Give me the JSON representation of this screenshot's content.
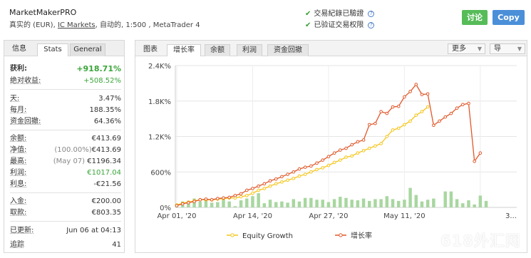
{
  "header": {
    "system_name": "MarketMakerPRO",
    "meta_prefix": "真实的 (EUR),",
    "broker_link": "IC Markets",
    "meta_suffix": ", 自动的, 1:500 , MetaTrader 4",
    "verify_1": "交易紀錄已驗證",
    "verify_2": "已验证交易权限",
    "discuss_label": "讨论",
    "copy_label": "Copy"
  },
  "left_panel": {
    "tabs": [
      "信息",
      "Stats",
      "General"
    ],
    "stats": {
      "gain_label": "获利:",
      "gain_value": "+918.71%",
      "absgain_label": "绝对收益:",
      "absgain_value": "+508.52%",
      "daily_label": "天:",
      "daily_value": "3.47%",
      "monthly_label": "每月:",
      "monthly_value": "188.35%",
      "drawdown_label": "资金回撤:",
      "drawdown_value": "64.36%",
      "balance_label": "余额:",
      "balance_value": "€413.69",
      "equity_label": "净值:",
      "equity_pct": "(100.00%)",
      "equity_value": "€413.69",
      "highest_label": "最高:",
      "highest_date": "(May 07)",
      "highest_value": "€1196.34",
      "profit_label": "利润:",
      "profit_value": "€1017.04",
      "interest_label": "利息:",
      "interest_value": "-€21.56",
      "deposits_label": "入金:",
      "deposits_value": "€200.00",
      "withdrawals_label": "取款:",
      "withdrawals_value": "€803.35",
      "updated_label": "已更新:",
      "updated_value": "Jun 06 at 04:13",
      "tracking_label": "追踪",
      "tracking_value": "41"
    }
  },
  "right_panel": {
    "tab_label": "图表",
    "tabs": [
      "增长率",
      "余额",
      "利润",
      "资金回撤"
    ],
    "more_label": "更多",
    "export_label": "导"
  },
  "chart_data": {
    "type": "line",
    "y_tick_labels": [
      "0%",
      "600%",
      "1.2K%",
      "1.8K%",
      "2.4K%"
    ],
    "ylim": [
      0,
      2400
    ],
    "x_tick_labels": [
      "Apr 01, '20",
      "Apr 14, '20",
      "Apr 27, '20",
      "May 11, '20",
      "3..."
    ],
    "grid": true,
    "legend_position": "bottom",
    "series": [
      {
        "name": "Equity Growth",
        "color": "#f5c518",
        "values": [
          40,
          70,
          90,
          110,
          130,
          130,
          125,
          140,
          150,
          160,
          160,
          180,
          200,
          240,
          290,
          320,
          360,
          400,
          430,
          460,
          490,
          530,
          560,
          600,
          640,
          670,
          710,
          760,
          800,
          850,
          870,
          920,
          960,
          1000,
          1040,
          1080,
          1200,
          1310,
          1340,
          1400,
          1460,
          1560,
          1620,
          1700,
          null,
          null,
          null,
          null,
          null,
          null,
          null,
          null,
          null,
          null,
          null,
          null,
          null,
          null,
          null
        ]
      },
      {
        "name": "增长率",
        "color": "#e0582a",
        "values": [
          30,
          60,
          80,
          100,
          130,
          140,
          130,
          150,
          160,
          170,
          200,
          230,
          290,
          320,
          360,
          400,
          450,
          480,
          520,
          560,
          600,
          650,
          680,
          700,
          750,
          800,
          860,
          920,
          970,
          1000,
          1060,
          1110,
          1140,
          1400,
          1420,
          1620,
          1590,
          1700,
          1710,
          1870,
          1960,
          2080,
          1910,
          1920,
          1390,
          1460,
          1530,
          1590,
          1680,
          1740,
          1760,
          780,
          920,
          null,
          null,
          null,
          null,
          null,
          null
        ]
      }
    ],
    "bars": {
      "name": "daily",
      "color": "#a8d7a0",
      "values": [
        60,
        100,
        90,
        150,
        100,
        130,
        80,
        90,
        150,
        100,
        20,
        120,
        150,
        190,
        240,
        70,
        130,
        90,
        100,
        80,
        140,
        100,
        160,
        160,
        130,
        130,
        90,
        140,
        180,
        160,
        130,
        120,
        150,
        110,
        140,
        140,
        190,
        140,
        110,
        130,
        330,
        210,
        100,
        130,
        150,
        0,
        270,
        270,
        140,
        70,
        120,
        50,
        200,
        110,
        0,
        0,
        0,
        0,
        0
      ]
    }
  },
  "watermark": "618外汇网"
}
